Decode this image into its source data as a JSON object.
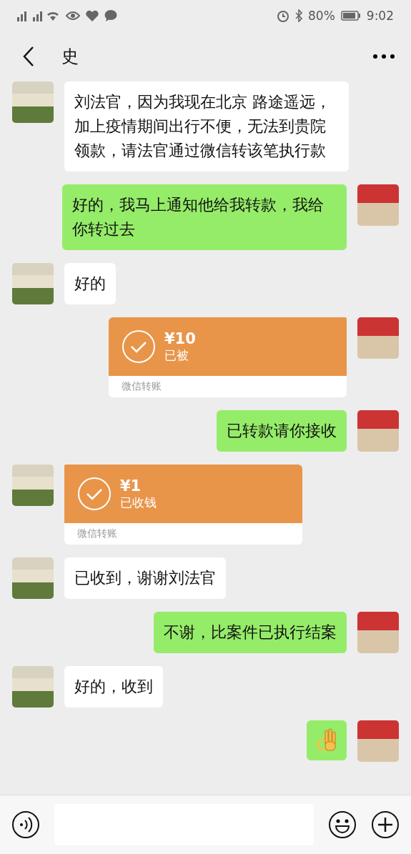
{
  "status_bar": {
    "battery": "80%",
    "time": "9:02"
  },
  "header": {
    "title": "史"
  },
  "messages": [
    {
      "outgoing": false,
      "kind": "text",
      "text": "刘法官，因为我现在北京 路途遥远，加上疫情期间出行不便，无法到贵院领款，请法官通过微信转该笔执行款"
    },
    {
      "outgoing": true,
      "kind": "text",
      "text": "好的，我马上通知他给我转款，我给你转过去"
    },
    {
      "outgoing": false,
      "kind": "text",
      "text": "好的"
    },
    {
      "outgoing": true,
      "kind": "transfer",
      "amount": "¥10",
      "status": "已被",
      "footer": "微信转账"
    },
    {
      "outgoing": true,
      "kind": "text",
      "text": "已转款请你接收"
    },
    {
      "outgoing": false,
      "kind": "transfer",
      "amount": "¥1",
      "status": "已收钱",
      "footer": "微信转账"
    },
    {
      "outgoing": false,
      "kind": "text",
      "text": "已收到，谢谢刘法官"
    },
    {
      "outgoing": true,
      "kind": "text",
      "text": "不谢，比案件已执行结案"
    },
    {
      "outgoing": false,
      "kind": "text",
      "text": "好的，收到"
    },
    {
      "outgoing": true,
      "kind": "emoji"
    }
  ]
}
